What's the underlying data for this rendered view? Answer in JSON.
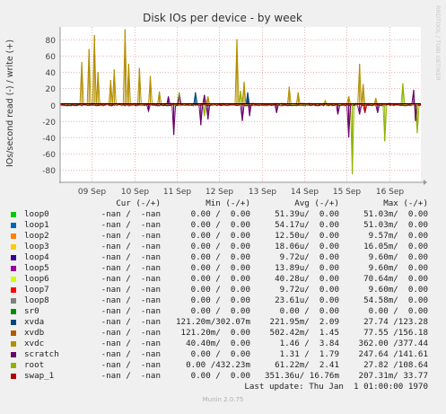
{
  "chart_data": {
    "type": "line",
    "title": "Disk IOs per device - by week",
    "ylabel": "IOs/second read (-) / write (+)",
    "ylim": [
      -95,
      95
    ],
    "yticks": [
      80,
      60,
      40,
      20,
      0,
      -20,
      -40,
      -60,
      -80
    ],
    "xticks": [
      "09 Sep",
      "10 Sep",
      "11 Sep",
      "12 Sep",
      "13 Sep",
      "14 Sep",
      "15 Sep",
      "16 Sep"
    ],
    "grid": true,
    "watermark": "RRDTOOL / TOBI OETIKER",
    "series": [
      {
        "name": "loop0",
        "color": "#00cc00"
      },
      {
        "name": "loop1",
        "color": "#0066b3"
      },
      {
        "name": "loop2",
        "color": "#ff8000"
      },
      {
        "name": "loop3",
        "color": "#ffcc00"
      },
      {
        "name": "loop4",
        "color": "#330099"
      },
      {
        "name": "loop5",
        "color": "#990099"
      },
      {
        "name": "loop6",
        "color": "#ccff00"
      },
      {
        "name": "loop7",
        "color": "#ff0000"
      },
      {
        "name": "loop8",
        "color": "#808080"
      },
      {
        "name": "sr0",
        "color": "#008f00"
      },
      {
        "name": "xvda",
        "color": "#00487d"
      },
      {
        "name": "xvdb",
        "color": "#b35a00"
      },
      {
        "name": "xvdc",
        "color": "#b38f00"
      },
      {
        "name": "scratch",
        "color": "#6b006b"
      },
      {
        "name": "root",
        "color": "#8fb300"
      },
      {
        "name": "swap_1",
        "color": "#b30000"
      }
    ],
    "peaks": [
      {
        "series": "xvdc",
        "x": 0.06,
        "y": 52
      },
      {
        "series": "xvdc",
        "x": 0.08,
        "y": 68
      },
      {
        "series": "xvdc",
        "x": 0.095,
        "y": 85
      },
      {
        "series": "xvdc",
        "x": 0.105,
        "y": 40
      },
      {
        "series": "xvdc",
        "x": 0.14,
        "y": 30
      },
      {
        "series": "xvdc",
        "x": 0.15,
        "y": 43
      },
      {
        "series": "xvdc",
        "x": 0.18,
        "y": 92
      },
      {
        "series": "xvdc",
        "x": 0.19,
        "y": 50
      },
      {
        "series": "xvdc",
        "x": 0.22,
        "y": 45
      },
      {
        "series": "xvdc",
        "x": 0.25,
        "y": 35
      },
      {
        "series": "xvdc",
        "x": 0.275,
        "y": 16
      },
      {
        "series": "xvdc",
        "x": 0.41,
        "y": 10
      },
      {
        "series": "xvdc",
        "x": 0.49,
        "y": 80
      },
      {
        "series": "xvdc",
        "x": 0.51,
        "y": 28
      },
      {
        "series": "xvdc",
        "x": 0.635,
        "y": 22
      },
      {
        "series": "xvdc",
        "x": 0.66,
        "y": 15
      },
      {
        "series": "xvdc",
        "x": 0.8,
        "y": 10
      },
      {
        "series": "xvdc",
        "x": 0.83,
        "y": 50
      },
      {
        "series": "xvdc",
        "x": 0.84,
        "y": 25
      },
      {
        "series": "xvdc",
        "x": 0.875,
        "y": 8
      },
      {
        "series": "scratch",
        "x": 0.315,
        "y": -37
      },
      {
        "series": "scratch",
        "x": 0.245,
        "y": -8
      },
      {
        "series": "scratch",
        "x": 0.39,
        "y": -25
      },
      {
        "series": "scratch",
        "x": 0.41,
        "y": -18
      },
      {
        "series": "scratch",
        "x": 0.505,
        "y": -20
      },
      {
        "series": "scratch",
        "x": 0.525,
        "y": -14
      },
      {
        "series": "scratch",
        "x": 0.6,
        "y": -10
      },
      {
        "series": "scratch",
        "x": 0.77,
        "y": -12
      },
      {
        "series": "scratch",
        "x": 0.8,
        "y": -40
      },
      {
        "series": "scratch",
        "x": 0.83,
        "y": -12
      },
      {
        "series": "scratch",
        "x": 0.88,
        "y": -10
      },
      {
        "series": "scratch",
        "x": 0.985,
        "y": -20
      },
      {
        "series": "scratch",
        "x": 0.3,
        "y": 10
      },
      {
        "series": "scratch",
        "x": 0.33,
        "y": 14
      },
      {
        "series": "scratch",
        "x": 0.4,
        "y": 12
      },
      {
        "series": "scratch",
        "x": 0.52,
        "y": 8
      },
      {
        "series": "scratch",
        "x": 0.98,
        "y": 18
      },
      {
        "series": "root",
        "x": 0.33,
        "y": 15
      },
      {
        "series": "root",
        "x": 0.5,
        "y": 17
      },
      {
        "series": "root",
        "x": 0.735,
        "y": 5
      },
      {
        "series": "root",
        "x": 0.95,
        "y": 26
      },
      {
        "series": "root",
        "x": 0.81,
        "y": -85
      },
      {
        "series": "root",
        "x": 0.9,
        "y": -45
      },
      {
        "series": "root",
        "x": 0.99,
        "y": -35
      },
      {
        "series": "root",
        "x": 0.4,
        "y": -14
      },
      {
        "series": "xvda",
        "x": 0.375,
        "y": 15
      },
      {
        "series": "xvda",
        "x": 0.52,
        "y": 15
      },
      {
        "series": "swap_1",
        "x": 0.845,
        "y": -10
      }
    ]
  },
  "legend": {
    "headers": {
      "cur": "Cur (-/+)",
      "min": "Min (-/+)",
      "avg": "Avg (-/+)",
      "max": "Max (-/+)"
    },
    "rows": [
      {
        "name": "loop0",
        "color": "#00cc00",
        "cur": "-nan /  -nan",
        "min": "0.00 /  0.00",
        "avg": "51.39u/  0.00",
        "max": "51.03m/  0.00"
      },
      {
        "name": "loop1",
        "color": "#0066b3",
        "cur": "-nan /  -nan",
        "min": "0.00 /  0.00",
        "avg": "54.17u/  0.00",
        "max": "51.03m/  0.00"
      },
      {
        "name": "loop2",
        "color": "#ff8000",
        "cur": "-nan /  -nan",
        "min": "0.00 /  0.00",
        "avg": "12.50u/  0.00",
        "max": "9.57m/  0.00"
      },
      {
        "name": "loop3",
        "color": "#ffcc00",
        "cur": "-nan /  -nan",
        "min": "0.00 /  0.00",
        "avg": "18.06u/  0.00",
        "max": "16.05m/  0.00"
      },
      {
        "name": "loop4",
        "color": "#330099",
        "cur": "-nan /  -nan",
        "min": "0.00 /  0.00",
        "avg": "9.72u/  0.00",
        "max": "9.60m/  0.00"
      },
      {
        "name": "loop5",
        "color": "#990099",
        "cur": "-nan /  -nan",
        "min": "0.00 /  0.00",
        "avg": "13.89u/  0.00",
        "max": "9.60m/  0.00"
      },
      {
        "name": "loop6",
        "color": "#ccff00",
        "cur": "-nan /  -nan",
        "min": "0.00 /  0.00",
        "avg": "40.28u/  0.00",
        "max": "70.64m/  0.00"
      },
      {
        "name": "loop7",
        "color": "#ff0000",
        "cur": "-nan /  -nan",
        "min": "0.00 /  0.00",
        "avg": "9.72u/  0.00",
        "max": "9.60m/  0.00"
      },
      {
        "name": "loop8",
        "color": "#808080",
        "cur": "-nan /  -nan",
        "min": "0.00 /  0.00",
        "avg": "23.61u/  0.00",
        "max": "54.58m/  0.00"
      },
      {
        "name": "sr0",
        "color": "#008f00",
        "cur": "-nan /  -nan",
        "min": "0.00 /  0.00",
        "avg": "0.00 /  0.00",
        "max": "0.00 /  0.00"
      },
      {
        "name": "xvda",
        "color": "#00487d",
        "cur": "-nan /  -nan",
        "min": "121.20m/302.07m",
        "avg": "221.95m/  2.09",
        "max": "27.74 /123.28"
      },
      {
        "name": "xvdb",
        "color": "#b35a00",
        "cur": "-nan /  -nan",
        "min": "121.20m/  0.00",
        "avg": "502.42m/  1.45",
        "max": "77.55 /156.18"
      },
      {
        "name": "xvdc",
        "color": "#b38f00",
        "cur": "-nan /  -nan",
        "min": "40.40m/  0.00",
        "avg": "1.46 /  3.84",
        "max": "362.00 /377.44"
      },
      {
        "name": "scratch",
        "color": "#6b006b",
        "cur": "-nan /  -nan",
        "min": "0.00 /  0.00",
        "avg": "1.31 /  1.79",
        "max": "247.64 /141.61"
      },
      {
        "name": "root",
        "color": "#8fb300",
        "cur": "-nan /  -nan",
        "min": "0.00 /432.23m",
        "avg": "61.22m/  2.41",
        "max": "27.82 /108.64"
      },
      {
        "name": "swap_1",
        "color": "#b30000",
        "cur": "-nan /  -nan",
        "min": "0.00 /  0.00",
        "avg": "351.36u/ 16.76m",
        "max": "207.31m/ 33.77"
      }
    ],
    "last_update": "Last update: Thu Jan  1 01:00:00 1970"
  },
  "footer": "Munin 2.0.75"
}
